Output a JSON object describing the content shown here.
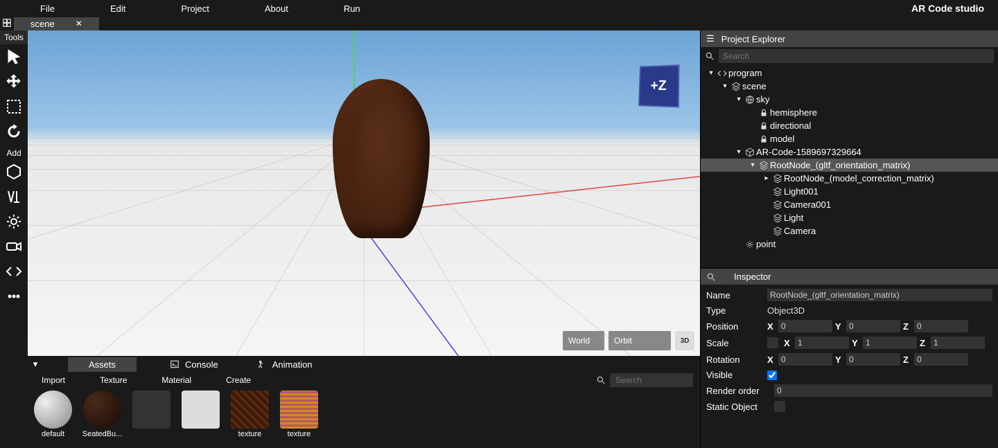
{
  "app_title": "AR Code studio",
  "menu": [
    "File",
    "Edit",
    "Project",
    "About",
    "Run"
  ],
  "scene_tab": "scene",
  "tools_header": "Tools",
  "add_label": "Add",
  "viewport": {
    "axis_indicator": "+Z",
    "space_select": "World",
    "camera_select": "Orbit",
    "cube_btn": "3D"
  },
  "bottom_tabs": {
    "assets": "Assets",
    "console": "Console",
    "animation": "Animation"
  },
  "sub_tabs": [
    "Import",
    "Texture",
    "Material",
    "Create"
  ],
  "search_placeholder": "Search",
  "assets": [
    {
      "label": "default",
      "kind": "sphere"
    },
    {
      "label": "SeatedBu...",
      "kind": "dark"
    },
    {
      "label": "",
      "kind": "line"
    },
    {
      "label": "",
      "kind": "white"
    },
    {
      "label": "texture",
      "kind": "tex1"
    },
    {
      "label": "texture",
      "kind": "tex2"
    }
  ],
  "explorer": {
    "title": "Project Explorer",
    "search_placeholder": "Search",
    "tree": [
      {
        "depth": 0,
        "chev": "▾",
        "icon": "code",
        "label": "program"
      },
      {
        "depth": 1,
        "chev": "▾",
        "icon": "scene",
        "label": "scene"
      },
      {
        "depth": 2,
        "chev": "▾",
        "icon": "globe",
        "label": "sky"
      },
      {
        "depth": 3,
        "chev": "",
        "icon": "lock",
        "label": "hemisphere"
      },
      {
        "depth": 3,
        "chev": "",
        "icon": "lock",
        "label": "directional"
      },
      {
        "depth": 3,
        "chev": "",
        "icon": "lock",
        "label": "model"
      },
      {
        "depth": 2,
        "chev": "▾",
        "icon": "box",
        "label": "AR-Code-1589697329664"
      },
      {
        "depth": 3,
        "chev": "▾",
        "icon": "scene",
        "label": "RootNode_(gltf_orientation_matrix)",
        "selected": true
      },
      {
        "depth": 4,
        "chev": "▸",
        "icon": "scene",
        "label": "RootNode_(model_correction_matrix)"
      },
      {
        "depth": 4,
        "chev": "",
        "icon": "scene",
        "label": "Light001"
      },
      {
        "depth": 4,
        "chev": "",
        "icon": "scene",
        "label": "Camera001"
      },
      {
        "depth": 4,
        "chev": "",
        "icon": "scene",
        "label": "Light"
      },
      {
        "depth": 4,
        "chev": "",
        "icon": "scene",
        "label": "Camera"
      },
      {
        "depth": 2,
        "chev": "",
        "icon": "point",
        "label": "point"
      }
    ]
  },
  "inspector": {
    "title": "Inspector",
    "name_label": "Name",
    "name_value": "RootNode_(gltf_orientation_matrix)",
    "type_label": "Type",
    "type_value": "Object3D",
    "position_label": "Position",
    "position": {
      "x": "0",
      "y": "0",
      "z": "0"
    },
    "scale_label": "Scale",
    "scale": {
      "x": "1",
      "y": "1",
      "z": "1"
    },
    "rotation_label": "Rotation",
    "rotation": {
      "x": "0",
      "y": "0",
      "z": "0"
    },
    "visible_label": "Visible",
    "visible": true,
    "render_order_label": "Render order",
    "render_order": "0",
    "static_label": "Static Object",
    "static": false
  }
}
